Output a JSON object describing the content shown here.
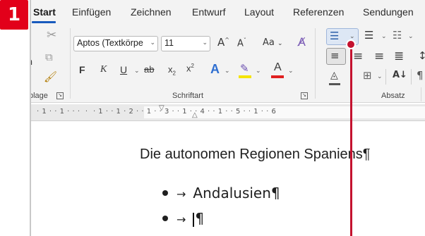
{
  "step_badge": "1",
  "tabs": [
    "Start",
    "Einfügen",
    "Zeichnen",
    "Entwurf",
    "Layout",
    "Referenzen",
    "Sendungen"
  ],
  "ribbon": {
    "clipboard_label": "blage",
    "font_name": "Aptos (Textkörpe",
    "font_size": "11",
    "grow_font": "A",
    "shrink_font": "A",
    "change_case": "Aa",
    "bold": "F",
    "italic": "K",
    "underline": "U",
    "strikethrough": "ab",
    "subscript": "x",
    "superscript": "x",
    "text_effects": "A",
    "font_color": "A",
    "font_group_label": "Schriftart",
    "paragraph_group_label": "Absatz",
    "h_stub": "h"
  },
  "ruler": {
    "marks": "· 1 · · 1 · · ·  ·  · 1 · · 1 · 2 · · 1 · · 3 · · 1 · · 4 · · 1 · · 5 · · 1 · · 6"
  },
  "document": {
    "title": "Die autonomen Regionen Spaniens¶",
    "bullet_1_arrow": "→",
    "bullet_1_text": "Andalusien¶",
    "bullet_2_arrow": "→",
    "bullet_2_text": "¶"
  },
  "colors": {
    "badge": "#e2001a",
    "callout": "#c4122f",
    "highlight_color": "#f5e400",
    "font_color_bar": "#e02020",
    "text_effects_blue": "#2f6fd1"
  },
  "icons": [
    "cut-icon",
    "copy-icon",
    "format-painter-icon",
    "bullets-icon",
    "numbering-icon",
    "multilevel-list-icon",
    "align-left-icon",
    "align-center-icon",
    "align-right-icon",
    "justify-icon",
    "shading-icon",
    "borders-icon",
    "sort-icon",
    "clear-formatting-icon"
  ]
}
